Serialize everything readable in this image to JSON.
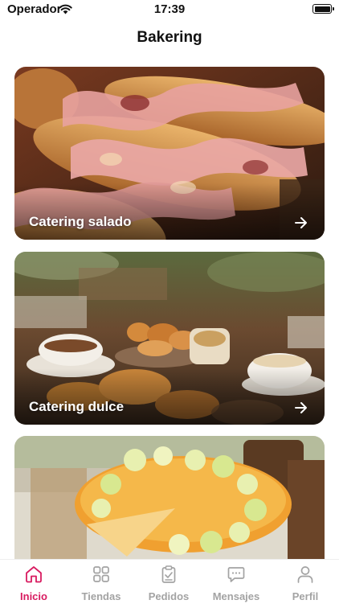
{
  "status_bar": {
    "carrier": "Operador",
    "time": "17:39"
  },
  "header": {
    "title": "Bakering"
  },
  "cards": [
    {
      "label": "Catering salado"
    },
    {
      "label": "Catering dulce"
    },
    {
      "label": ""
    }
  ],
  "tab_bar": {
    "active_color": "#d81b60",
    "inactive_color": "#a3a3a3",
    "tabs": [
      {
        "label": "Inicio",
        "icon": "home-icon",
        "active": true
      },
      {
        "label": "Tiendas",
        "icon": "grid-icon",
        "active": false
      },
      {
        "label": "Pedidos",
        "icon": "clipboard-icon",
        "active": false
      },
      {
        "label": "Mensajes",
        "icon": "chat-icon",
        "active": false
      },
      {
        "label": "Perfil",
        "icon": "person-icon",
        "active": false
      }
    ]
  }
}
